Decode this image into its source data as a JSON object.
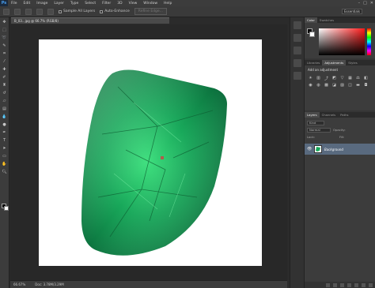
{
  "app": {
    "logo": "Ps",
    "window_controls": [
      "–",
      "□",
      "✕"
    ]
  },
  "menu": [
    "File",
    "Edit",
    "Image",
    "Layer",
    "Type",
    "Select",
    "Filter",
    "3D",
    "View",
    "Window",
    "Help"
  ],
  "options_bar": {
    "sample_all_layers": "Sample All Layers",
    "auto_enhance": "Auto-Enhance",
    "refine_edge": "Refine Edge...",
    "workspace": "Essentials"
  },
  "document": {
    "tab_title": "B_03...jpg @ 66.7% (RGB/8)"
  },
  "status": {
    "zoom": "66.67%",
    "doc_size": "Doc: 3.78M/3.29M"
  },
  "panels": {
    "color_tabs": [
      "Color",
      "Swatches"
    ],
    "adjust_tabs": [
      "Libraries",
      "Adjustments",
      "Styles"
    ],
    "adjust_title": "Add an adjustment",
    "layers_tabs": [
      "Layers",
      "Channels",
      "Paths"
    ],
    "kind_label": "Kind",
    "blend_mode": "Normal",
    "opacity_label": "Opacity:",
    "lock_label": "Lock:",
    "fill_label": "Fill:",
    "layer_name": "Background"
  },
  "icons": {
    "tools": [
      "move-icon",
      "marquee-icon",
      "lasso-icon",
      "quick-select-icon",
      "crop-icon",
      "eyedropper-icon",
      "healing-icon",
      "brush-icon",
      "clone-stamp-icon",
      "history-brush-icon",
      "eraser-icon",
      "gradient-icon",
      "blur-icon",
      "dodge-icon",
      "pen-icon",
      "type-icon",
      "path-select-icon",
      "shape-icon",
      "hand-icon",
      "zoom-icon"
    ]
  },
  "colors": {
    "gem_dark": "#0a6b3a",
    "gem_mid": "#18a85a",
    "gem_light": "#3fe07f",
    "layer_selected": "#596a7f"
  }
}
